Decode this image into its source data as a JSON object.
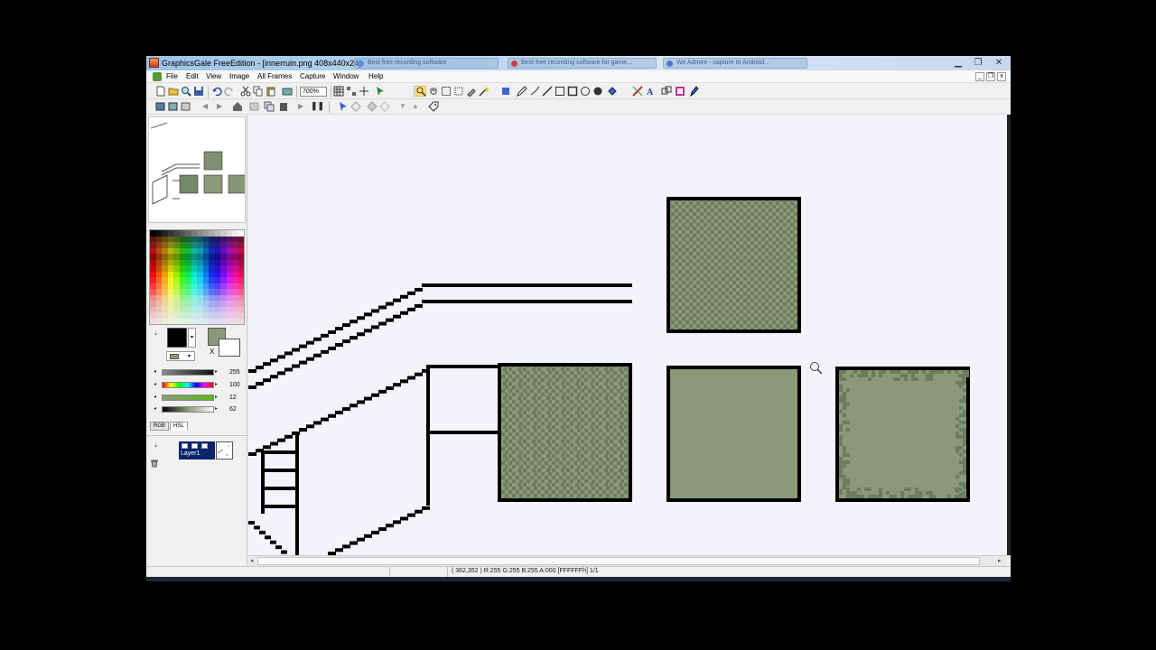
{
  "window": {
    "title": "GraphicsGale FreeEdition - [innerruin.png 408x440x24]",
    "background_tabs": [
      {
        "label": "Best free recording software"
      },
      {
        "label": "Best free recording software for game..."
      },
      {
        "label": "We Admire - capture to Android..."
      }
    ],
    "caption_buttons": {
      "minimize": "▁",
      "maximize": "❐",
      "close": "✕"
    }
  },
  "menu": {
    "items": [
      "File",
      "Edit",
      "View",
      "Image",
      "All Frames",
      "Capture",
      "Window",
      "Help"
    ],
    "mdi_buttons": [
      "_",
      "❐",
      "x"
    ]
  },
  "toolbar": {
    "zoom_level": "700%"
  },
  "left_panel": {
    "sliders": [
      {
        "value": "255",
        "color": "#111111"
      },
      {
        "value": "100",
        "color": "#ff0000"
      },
      {
        "value": "12",
        "color": "#6ab82c"
      },
      {
        "value": "62",
        "color": "#7a7a7a"
      }
    ],
    "tabs": [
      "RGB",
      "HSL"
    ],
    "layer": {
      "name": "Layer1"
    },
    "primary_color": "#000000",
    "secondary_color": "#8a9a78",
    "transparent_marker": "X"
  },
  "canvas": {
    "tile_fill": "#8a9a78",
    "tile_dark": "#6b7d5c",
    "outline": "#000000"
  },
  "status": {
    "text": "( 362,352 )  R:255 G:255 B:255 A:000   [FFFFFFh]  1/1"
  }
}
